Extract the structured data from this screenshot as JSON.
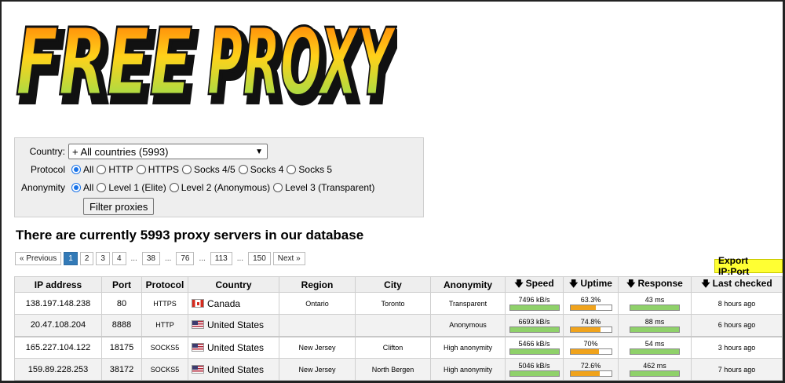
{
  "logo": {
    "text": "FREE PROXY"
  },
  "filter": {
    "country_label": "Country:",
    "country_value": "+ All countries (5993)",
    "protocol_label": "Protocol",
    "protocol_options": [
      "All",
      "HTTP",
      "HTTPS",
      "Socks 4/5",
      "Socks 4",
      "Socks 5"
    ],
    "protocol_selected": "All",
    "anonymity_label": "Anonymity",
    "anonymity_options": [
      "All",
      "Level 1 (Elite)",
      "Level 2 (Anonymous)",
      "Level 3 (Transparent)"
    ],
    "anonymity_selected": "All",
    "filter_button": "Filter proxies"
  },
  "heading": "There are currently 5993 proxy servers in our database",
  "pagination": {
    "previous": "« Previous",
    "pages": [
      "1",
      "2",
      "3",
      "4"
    ],
    "ellipsis": "...",
    "page_38": "38",
    "page_76": "76",
    "page_113": "113",
    "page_150": "150",
    "next": "Next »",
    "current": "1"
  },
  "export_button": "Export IP:Port",
  "table": {
    "headers": {
      "ip": "IP address",
      "port": "Port",
      "protocol": "Protocol",
      "country": "Country",
      "region": "Region",
      "city": "City",
      "anonymity": "Anonymity",
      "speed": "Speed",
      "uptime": "Uptime",
      "response": "Response",
      "last_checked": "Last checked"
    },
    "sort_icon": "arrow-down-icon",
    "rows": [
      {
        "ip": "138.197.148.238",
        "port": "80",
        "protocol": "HTTPS",
        "country": "Canada",
        "flag": "ca",
        "region": "Ontario",
        "city": "Toronto",
        "anonymity": "Transparent",
        "speed": "7496 kB/s",
        "speed_fraction": 1.0,
        "uptime": "63.3%",
        "uptime_fraction": 0.633,
        "response": "43 ms",
        "response_fraction": 1.0,
        "last_checked": "8 hours ago"
      },
      {
        "ip": "20.47.108.204",
        "port": "8888",
        "protocol": "HTTP",
        "country": "United States",
        "flag": "us",
        "region": "",
        "city": "",
        "anonymity": "Anonymous",
        "speed": "6693 kB/s",
        "speed_fraction": 1.0,
        "uptime": "74.8%",
        "uptime_fraction": 0.748,
        "response": "88 ms",
        "response_fraction": 1.0,
        "last_checked": "6 hours ago"
      },
      {
        "ip": "165.227.104.122",
        "port": "18175",
        "protocol": "SOCKS5",
        "country": "United States",
        "flag": "us",
        "region": "New Jersey",
        "city": "Clifton",
        "anonymity": "High anonymity",
        "speed": "5466 kB/s",
        "speed_fraction": 1.0,
        "uptime": "70%",
        "uptime_fraction": 0.7,
        "response": "54 ms",
        "response_fraction": 1.0,
        "last_checked": "3 hours ago"
      },
      {
        "ip": "159.89.228.253",
        "port": "38172",
        "protocol": "SOCKS5",
        "country": "United States",
        "flag": "us",
        "region": "New Jersey",
        "city": "North Bergen",
        "anonymity": "High anonymity",
        "speed": "5046 kB/s",
        "speed_fraction": 1.0,
        "uptime": "72.6%",
        "uptime_fraction": 0.726,
        "response": "462 ms",
        "response_fraction": 1.0,
        "last_checked": "7 hours ago"
      }
    ]
  },
  "colors": {
    "bar_green": "#8fd16a",
    "bar_orange": "#f0a31c",
    "pager_active": "#337ab7",
    "export_bg": "#ffff33",
    "form_bg": "#eeeeee"
  }
}
